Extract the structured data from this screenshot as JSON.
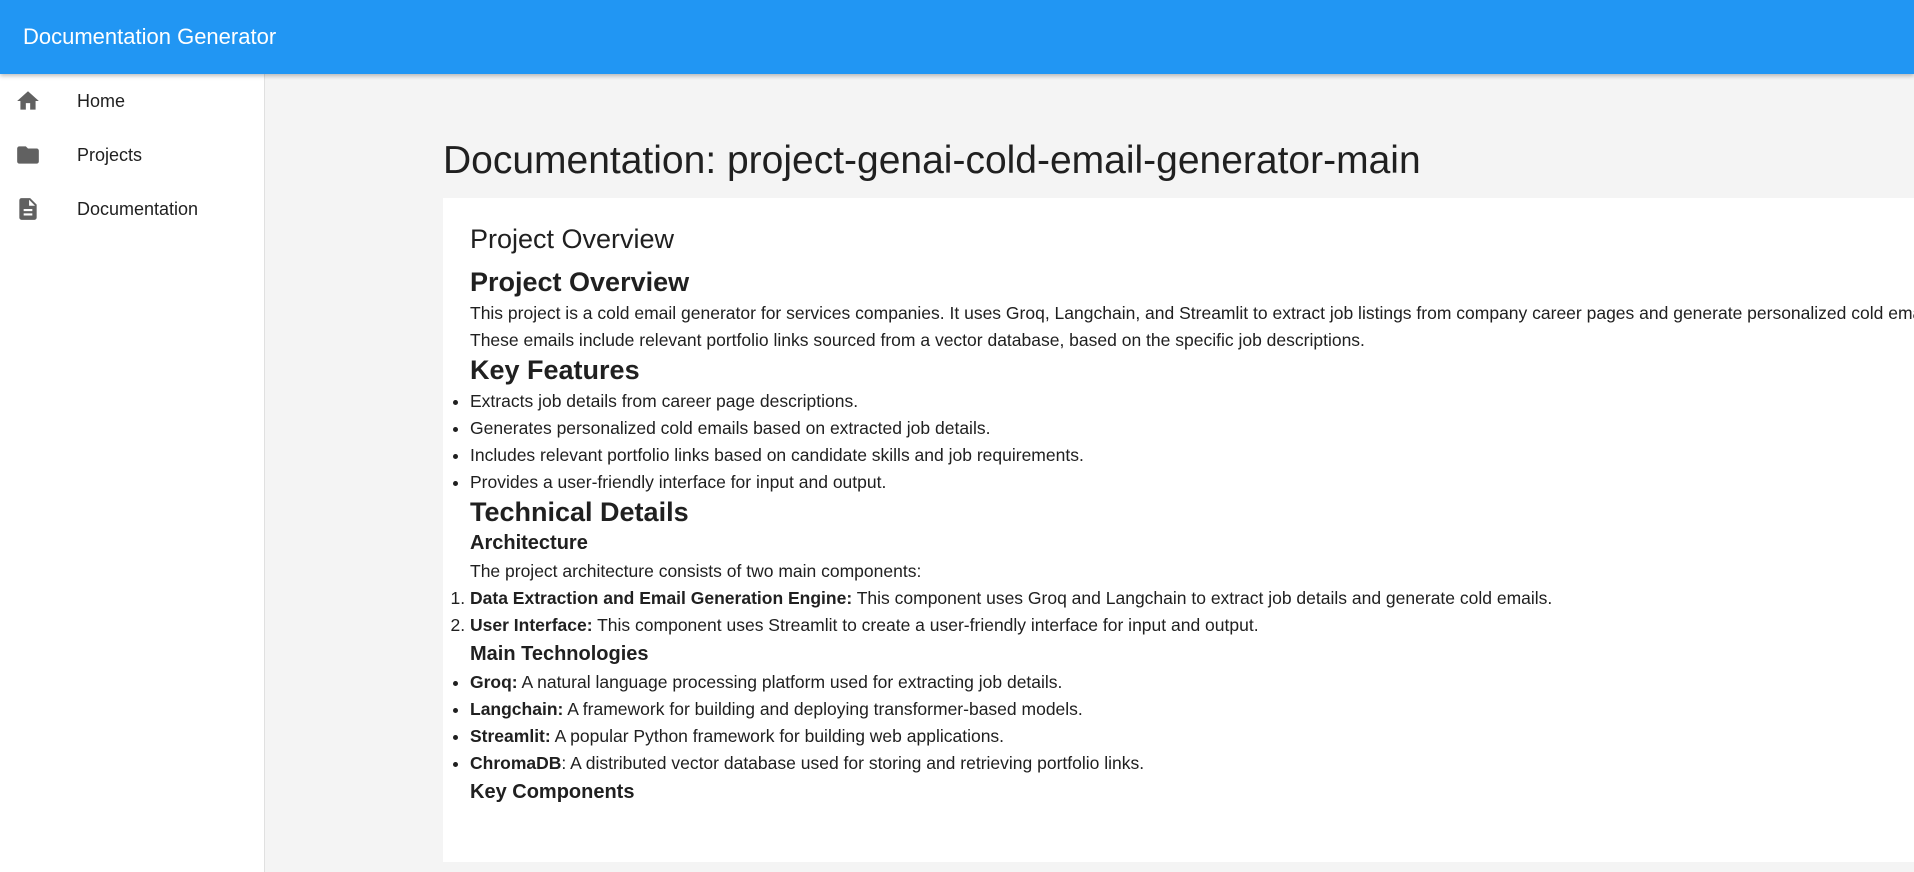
{
  "app": {
    "title": "Documentation Generator"
  },
  "sidebar": {
    "items": [
      {
        "label": "Home",
        "icon": "home-icon"
      },
      {
        "label": "Projects",
        "icon": "folder-icon"
      },
      {
        "label": "Documentation",
        "icon": "document-icon"
      }
    ]
  },
  "main": {
    "title": "Documentation: project-genai-cold-email-generator-main",
    "doc": {
      "section_heading": "Project Overview",
      "overview_heading": "Project Overview",
      "overview_text": "This project is a cold email generator for services companies. It uses Groq, Langchain, and Streamlit to extract job listings from company career pages and generate personalized cold emails. These emails include relevant portfolio links sourced from a vector database, based on the specific job descriptions.",
      "features_heading": "Key Features",
      "features": [
        "Extracts job details from career page descriptions.",
        "Generates personalized cold emails based on extracted job details.",
        "Includes relevant portfolio links based on candidate skills and job requirements.",
        "Provides a user-friendly interface for input and output."
      ],
      "technical_heading": "Technical Details",
      "architecture_heading": "Architecture",
      "architecture_intro": "The project architecture consists of two main components:",
      "components": [
        {
          "name": "Data Extraction and Email Generation Engine:",
          "desc": " This component uses Groq and Langchain to extract job details and generate cold emails."
        },
        {
          "name": "User Interface:",
          "desc": " This component uses Streamlit to create a user-friendly interface for input and output."
        }
      ],
      "technologies_heading": "Main Technologies",
      "technologies": [
        {
          "name": "Groq:",
          "desc": " A natural language processing platform used for extracting job details."
        },
        {
          "name": "Langchain:",
          "desc": " A framework for building and deploying transformer-based models."
        },
        {
          "name": "Streamlit:",
          "desc": " A popular Python framework for building web applications."
        },
        {
          "name": "ChromaDB",
          "desc": ": A distributed vector database used for storing and retrieving portfolio links."
        }
      ],
      "key_components_heading": "Key Components"
    }
  }
}
